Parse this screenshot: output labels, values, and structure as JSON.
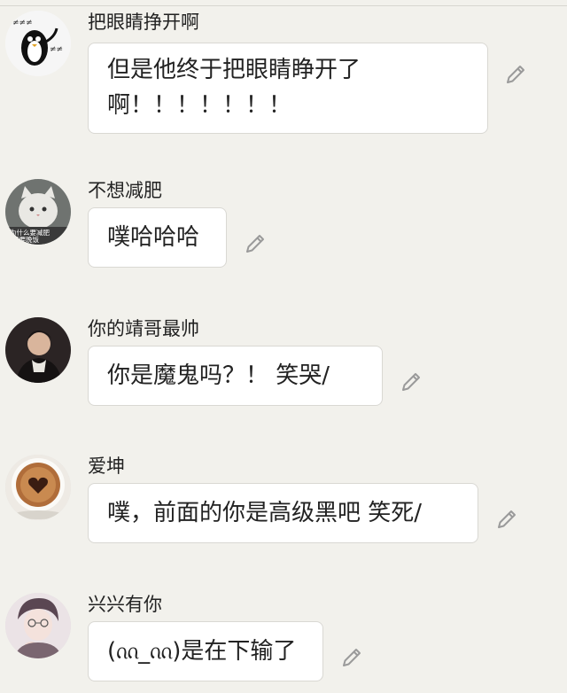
{
  "messages": [
    {
      "username": "把眼睛挣开啊",
      "text": "但是他终于把眼睛睁开了\n啊！！！！！！！",
      "avatar_icon": "penguin-avatar-icon"
    },
    {
      "username": "不想减肥",
      "text": "噗哈哈哈",
      "avatar_icon": "cat-avatar-icon",
      "avatar_caption": "为什么要减肥 不要晚饭"
    },
    {
      "username": "你的靖哥最帅",
      "text": "你是魔鬼吗？！ 笑哭/",
      "avatar_icon": "man-photo-avatar-icon"
    },
    {
      "username": "爱坤",
      "text": "噗，前面的你是高级黑吧 笑死/",
      "avatar_icon": "coffee-heart-avatar-icon"
    },
    {
      "username": "兴兴有你",
      "text": "(ᦶ_ᦶ)是在下输了",
      "avatar_icon": "anime-boy-avatar-icon"
    }
  ],
  "edit_icon": "pencil-icon",
  "colors": {
    "background": "#f2f1ec",
    "bubble": "#ffffff",
    "bubble_border": "#d9d8d3",
    "text": "#222222",
    "icon": "#9a9a9a"
  }
}
